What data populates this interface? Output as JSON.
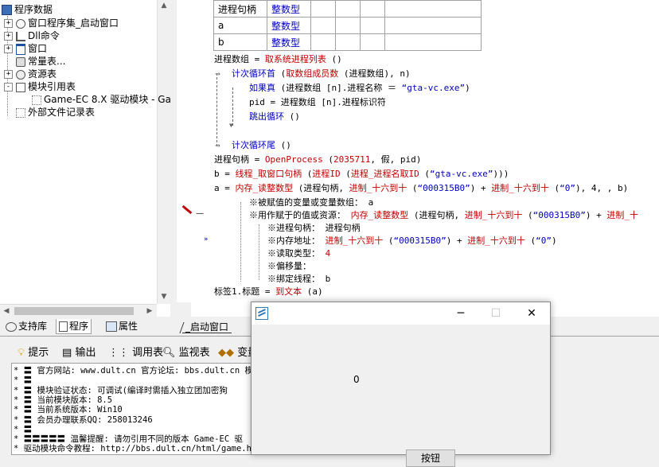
{
  "tree": {
    "root": "程序数据",
    "items": [
      {
        "label": "窗口程序集_启动窗口",
        "icon": "gear-icon",
        "indent": 1,
        "expander": "+"
      },
      {
        "label": "Dll命令",
        "icon": "dll-icon",
        "indent": 1,
        "expander": "+"
      },
      {
        "label": "窗口",
        "icon": "window-icon",
        "indent": 1,
        "expander": "+"
      },
      {
        "label": "常量表...",
        "icon": "constant-icon",
        "indent": 1,
        "expander": ""
      },
      {
        "label": "资源表",
        "icon": "resource-icon",
        "indent": 1,
        "expander": "+"
      },
      {
        "label": "模块引用表",
        "icon": "module-icon",
        "indent": 1,
        "expander": "-"
      },
      {
        "label": "Game-EC 8.X 驱动模块 - Ga",
        "icon": "file-icon",
        "indent": 2,
        "expander": ""
      },
      {
        "label": "外部文件记录表",
        "icon": "file-icon",
        "indent": 1,
        "expander": ""
      }
    ],
    "tabs": [
      "支持库",
      "程序",
      "属性"
    ]
  },
  "editor": {
    "vars": [
      {
        "name": "进程句柄",
        "type": "整数型"
      },
      {
        "name": "a",
        "type": "整数型"
      },
      {
        "name": "b",
        "type": "整数型"
      }
    ],
    "tabs": [
      "_启动窗口"
    ],
    "lines": {
      "l1": [
        "进程数组",
        " = ",
        "取系统进程列表",
        " ()"
      ],
      "l2": [
        "计次循环首",
        " (",
        "取数组成员数",
        " (进程数组), n)"
      ],
      "l3": [
        "如果真",
        " (进程数组 [n].进程名称 ＝ ",
        "“gta-vc.exe”",
        ")"
      ],
      "l4": "pid = 进程数组 [n].进程标识符",
      "l5": [
        "跳出循环",
        " ()"
      ],
      "l6": [
        "计次循环尾",
        " ()"
      ],
      "l7": [
        "进程句柄 = ",
        "OpenProcess",
        " (",
        "2035711",
        ", 假, pid)"
      ],
      "l8": [
        "b = ",
        "线程_取窗口句柄",
        " (",
        "进程ID",
        " (",
        "进程_进程名取ID",
        " (",
        "“gta-vc.exe”",
        ")))"
      ],
      "l9": [
        "a = ",
        "内存_读整数型",
        " (进程句柄, ",
        "进制_十六到十",
        " (",
        "“000315B0”",
        ") + ",
        "进制_十六到十",
        " (",
        "“0”",
        "), 4, , b)"
      ],
      "l10": [
        "※被赋值的变量或变量数组：",
        " a"
      ],
      "l11": [
        "※用作赋于的值或资源：",
        " 内存_读整数型",
        " (进程句柄, ",
        "进制_十六到十",
        " (",
        "“000315B0”",
        ") + ",
        "进制_十"
      ],
      "l12": [
        "※进程句柄：",
        " 进程句柄"
      ],
      "l13": [
        "※内存地址：",
        " 进制_十六到十",
        " (",
        "“000315B0”",
        ") + ",
        "进制_十六到十",
        " (",
        "“0”",
        ")"
      ],
      "l14": [
        "※读取类型：",
        " 4"
      ],
      "l15": "※偏移量：",
      "l16": [
        "※绑定线程：",
        " b"
      ],
      "l17": [
        "标签1.标题 = ",
        "到文本",
        " (a)"
      ]
    }
  },
  "output_toolbar": [
    "提示",
    "输出",
    "调用表",
    "监视表",
    "变量"
  ],
  "output_lines": [
    "* 〓 官方网站: www.dult.cn 官方论坛: bbs.dult.cn 模",
    "* 〓",
    "* 〓 模块验证状态: 可调试(编译时需插入独立团加密狗",
    "* 〓 当前模块版本: 8.5",
    "* 〓 当前系统版本: Win10",
    "* 〓 会员办理联系QQ: 258013246",
    "* 〓",
    "* 〓〓〓〓〓 温馨提醒: 请勿引用不同的版本 Game-EC 驱",
    "* 驱动模块命令教程: http://bbs.dult.cn/html/game.h"
  ],
  "dialog": {
    "label": "0",
    "button": "按钮",
    "title_buttons": {
      "minimize": "─",
      "maximize": "☐",
      "close": "✕"
    }
  },
  "colors": {
    "keyword": "#0000c0",
    "function": "#c00000",
    "string": "#0000c0"
  }
}
